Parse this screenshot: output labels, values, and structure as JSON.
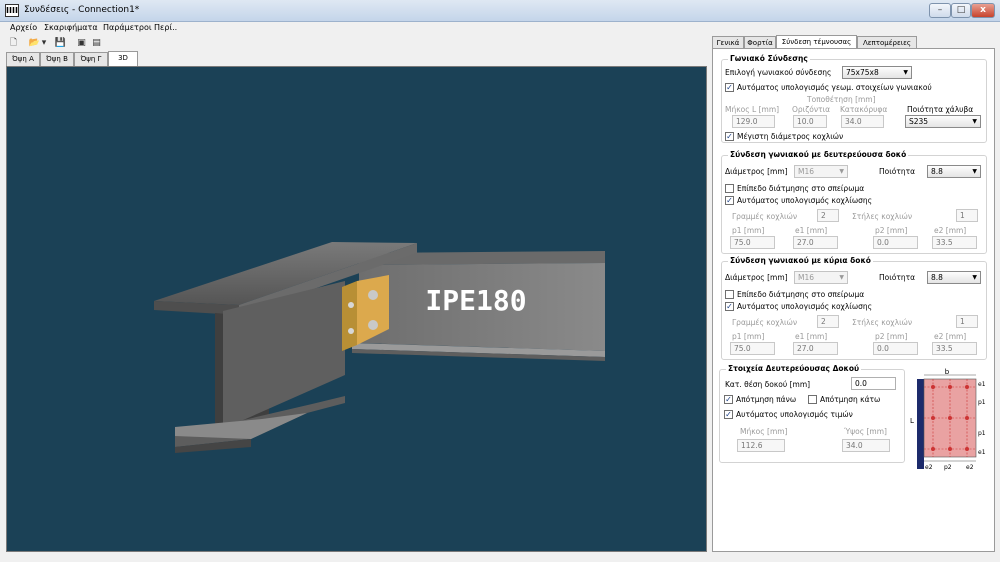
{
  "window": {
    "title": "Συνδέσεις - Connection1*",
    "app_icon": "IIII",
    "min": "–",
    "max": "□",
    "close": "x"
  },
  "menu": [
    "Αρχείο",
    "Σκαριφήματα",
    "Παράμετροι",
    "Περί.."
  ],
  "toolbar": {
    "icons": [
      "new-file-icon",
      "open-folder-icon",
      "dropdown-arrow-icon",
      "save-icon",
      "snapshot-icon",
      "print-icon"
    ],
    "glyphs": [
      "🗋",
      "📂",
      "▾",
      "💾",
      "▣",
      "▤"
    ]
  },
  "view_tabs": [
    "Όψη Α",
    "Όψη Β",
    "Όψη Γ",
    "3D"
  ],
  "viewport": {
    "beam_label": "IPE180",
    "background": "#1b4156"
  },
  "right_tabs": [
    "Γενικά",
    "Φορτία",
    "Σύνδεση τέμνουσας",
    "Λεπτομέρειες"
  ],
  "angle": {
    "title": "Γωνιακό Σύνδεσης",
    "select_label": "Επιλογή γωνιακού σύνδεσης",
    "select_value": "75x75x8",
    "auto_calc_label": "Αυτόματος υπολογισμός γεωμ. στοιχείων γωνιακού",
    "auto_calc_checked": "✓",
    "placement_label": "Τοποθέτηση [mm]",
    "length_label": "Μήκος L [mm]",
    "length_value": "129.0",
    "horizontal_label": "Οριζόντια",
    "horizontal_value": "10.0",
    "vertical_label": "Κατακόρυφα",
    "vertical_value": "34.0",
    "steel_label": "Ποιότητα χάλυβα",
    "steel_value": "S235",
    "maxdiam_label": "Μέγιστη διάμετρος κοχλιών",
    "maxdiam_checked": "✓"
  },
  "secondary": {
    "title": "Σύνδεση γωνιακού με δευτερεύουσα δοκό",
    "diam_label": "Διάμετρος [mm]",
    "diam_value": "M16",
    "quality_label": "Ποιότητα",
    "quality_value": "8.8",
    "thread_label": "Επίπεδο διάτμησης στο σπείρωμα",
    "auto_label": "Αυτόματος υπολογισμός κοχλίωσης",
    "auto_checked": "✓",
    "rows_label": "Γραμμές κοχλιών",
    "rows_value": "2",
    "cols_label": "Στήλες κοχλιών",
    "cols_value": "1",
    "p1_label": "p1 [mm]",
    "p1_value": "75.0",
    "e1_label": "e1 [mm]",
    "e1_value": "27.0",
    "p2_label": "p2 [mm]",
    "p2_value": "0.0",
    "e2_label": "e2 [mm]",
    "e2_value": "33.5"
  },
  "main": {
    "title": "Σύνδεση γωνιακού με κύρια δοκό",
    "diam_label": "Διάμετρος [mm]",
    "diam_value": "M16",
    "quality_label": "Ποιότητα",
    "quality_value": "8.8",
    "thread_label": "Επίπεδο διάτμησης στο σπείρωμα",
    "auto_label": "Αυτόματος υπολογισμός κοχλίωσης",
    "auto_checked": "✓",
    "rows_label": "Γραμμές κοχλιών",
    "rows_value": "2",
    "cols_label": "Στήλες κοχλιών",
    "cols_value": "1",
    "p1_label": "p1 [mm]",
    "p1_value": "75.0",
    "e1_label": "e1 [mm]",
    "e1_value": "27.0",
    "p2_label": "p2 [mm]",
    "p2_value": "0.0",
    "e2_label": "e2 [mm]",
    "e2_value": "33.5"
  },
  "beam": {
    "title": "Στοιχεία Δευτερεύουσας Δοκού",
    "pos_label": "Κατ. θέση δοκού [mm]",
    "pos_value": "0.0",
    "top_cut_label": "Απότμηση πάνω",
    "top_cut_checked": "✓",
    "bottom_cut_label": "Απότμηση κάτω",
    "bottom_cut_checked": "",
    "auto_label": "Αυτόματος υπολογισμός τιμών",
    "auto_checked": "✓",
    "length_label": "Μήκος [mm]",
    "length_value": "112.6",
    "height_label": "Ύψος [mm]",
    "height_value": "34.0"
  },
  "diagram": {
    "b": "b",
    "L": "L",
    "e1_top": "e1",
    "p1_a": "p1",
    "p1_b": "p1",
    "e1_bottom": "e1",
    "e2_left": "e2",
    "p2": "p2",
    "e2_right": "e2"
  }
}
